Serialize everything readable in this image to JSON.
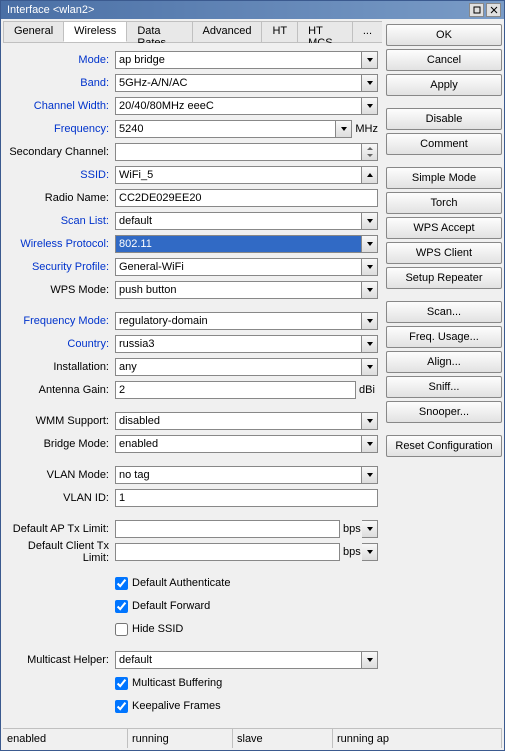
{
  "title": "Interface <wlan2>",
  "tabs": [
    "General",
    "Wireless",
    "Data Rates",
    "Advanced",
    "HT",
    "HT MCS",
    "..."
  ],
  "activeTab": 1,
  "buttons": [
    "OK",
    "Cancel",
    "Apply",
    "Disable",
    "Comment",
    "Simple Mode",
    "Torch",
    "WPS Accept",
    "WPS Client",
    "Setup Repeater",
    "Scan...",
    "Freq. Usage...",
    "Align...",
    "Sniff...",
    "Snooper...",
    "Reset Configuration"
  ],
  "btnGaps": [
    2,
    4,
    9,
    14
  ],
  "labels": {
    "mode": "Mode:",
    "band": "Band:",
    "cw": "Channel Width:",
    "freq": "Frequency:",
    "sec": "Secondary Channel:",
    "ssid": "SSID:",
    "radio": "Radio Name:",
    "scan": "Scan List:",
    "wproto": "Wireless Protocol:",
    "secprof": "Security Profile:",
    "wps": "WPS Mode:",
    "fmode": "Frequency Mode:",
    "country": "Country:",
    "inst": "Installation:",
    "again": "Antenna Gain:",
    "wmm": "WMM Support:",
    "bridge": "Bridge Mode:",
    "vmode": "VLAN Mode:",
    "vid": "VLAN ID:",
    "daptx": "Default AP Tx Limit:",
    "dctx": "Default Client Tx Limit:",
    "mhelper": "Multicast Helper:",
    "dauth": "Default Authenticate",
    "dfwd": "Default Forward",
    "hidessid": "Hide SSID",
    "mbuf": "Multicast Buffering",
    "kafrm": "Keepalive Frames"
  },
  "vals": {
    "mode": "ap bridge",
    "band": "5GHz-A/N/AC",
    "cw": "20/40/80MHz eeeC",
    "freq": "5240",
    "freq_unit": "MHz",
    "sec": "",
    "ssid": "WiFi_5",
    "radio": "CC2DE029EE20",
    "scan": "default",
    "wproto": "802.11",
    "secprof": "General-WiFi",
    "wps": "push button",
    "fmode": "regulatory-domain",
    "country": "russia3",
    "inst": "any",
    "again": "2",
    "again_unit": "dBi",
    "wmm": "disabled",
    "bridge": "enabled",
    "vmode": "no tag",
    "vid": "1",
    "daptx": "",
    "daptx_unit": "bps",
    "dctx": "",
    "dctx_unit": "bps",
    "mhelper": "default"
  },
  "checks": {
    "dauth": true,
    "dfwd": true,
    "hidessid": false,
    "mbuf": true,
    "kafrm": true
  },
  "status": [
    "enabled",
    "running",
    "slave",
    "running ap"
  ]
}
